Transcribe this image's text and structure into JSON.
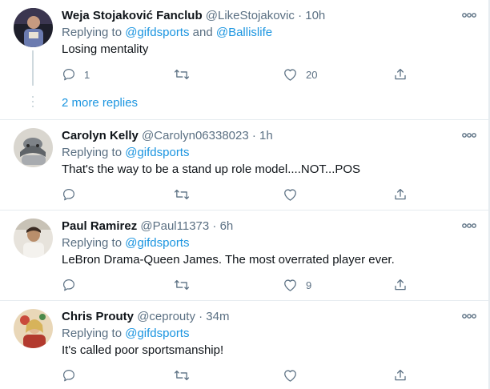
{
  "tweets": [
    {
      "name": "Weja Stojaković Fanclub",
      "handle": "@LikeStojakovic",
      "sep": "·",
      "time": "10h",
      "replying_prefix": "Replying to ",
      "mention1": "@gifdsports",
      "and_word": " and ",
      "mention2": "@Ballislife",
      "text": "Losing mentality",
      "reply_count": "1",
      "retweet_count": "",
      "like_count": "20",
      "more_replies": "2 more replies",
      "avatar_color": "#2a2a3a"
    },
    {
      "name": "Carolyn Kelly",
      "handle": "@Carolyn06338023",
      "sep": "·",
      "time": "1h",
      "replying_prefix": "Replying to ",
      "mention1": "@gifdsports",
      "text": "That's the way to be a stand up role model....NOT...POS",
      "reply_count": "",
      "retweet_count": "",
      "like_count": "",
      "avatar_color": "#8a8f94"
    },
    {
      "name": "Paul Ramirez",
      "handle": "@Paul11373",
      "sep": "·",
      "time": "6h",
      "replying_prefix": "Replying to ",
      "mention1": "@gifdsports",
      "text": "LeBron Drama-Queen James. The most overrated player ever.",
      "reply_count": "",
      "retweet_count": "",
      "like_count": "9",
      "avatar_color": "#c9a27a"
    },
    {
      "name": "Chris Prouty",
      "handle": "@ceprouty",
      "sep": "·",
      "time": "34m",
      "replying_prefix": "Replying to ",
      "mention1": "@gifdsports",
      "text": "It's called poor sportsmanship!",
      "reply_count": "",
      "retweet_count": "",
      "like_count": "",
      "avatar_color": "#b33a2e"
    }
  ],
  "colors": {
    "link": "#1b95e0",
    "muted": "#5b7083",
    "text": "#0f1419",
    "divider": "#e6ecf0"
  },
  "icons": [
    "more-icon",
    "reply-icon",
    "retweet-icon",
    "like-icon",
    "share-icon"
  ]
}
